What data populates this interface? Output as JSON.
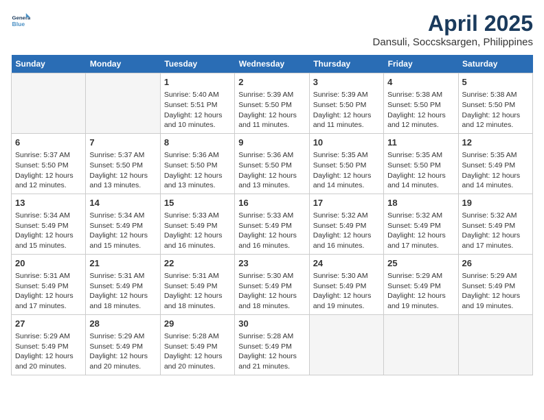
{
  "header": {
    "logo_line1": "General",
    "logo_line2": "Blue",
    "title": "April 2025",
    "subtitle": "Dansuli, Soccsksargen, Philippines"
  },
  "days_of_week": [
    "Sunday",
    "Monday",
    "Tuesday",
    "Wednesday",
    "Thursday",
    "Friday",
    "Saturday"
  ],
  "weeks": [
    [
      {
        "day": "",
        "info": ""
      },
      {
        "day": "",
        "info": ""
      },
      {
        "day": "1",
        "info": "Sunrise: 5:40 AM\nSunset: 5:51 PM\nDaylight: 12 hours and 10 minutes."
      },
      {
        "day": "2",
        "info": "Sunrise: 5:39 AM\nSunset: 5:50 PM\nDaylight: 12 hours and 11 minutes."
      },
      {
        "day": "3",
        "info": "Sunrise: 5:39 AM\nSunset: 5:50 PM\nDaylight: 12 hours and 11 minutes."
      },
      {
        "day": "4",
        "info": "Sunrise: 5:38 AM\nSunset: 5:50 PM\nDaylight: 12 hours and 12 minutes."
      },
      {
        "day": "5",
        "info": "Sunrise: 5:38 AM\nSunset: 5:50 PM\nDaylight: 12 hours and 12 minutes."
      }
    ],
    [
      {
        "day": "6",
        "info": "Sunrise: 5:37 AM\nSunset: 5:50 PM\nDaylight: 12 hours and 12 minutes."
      },
      {
        "day": "7",
        "info": "Sunrise: 5:37 AM\nSunset: 5:50 PM\nDaylight: 12 hours and 13 minutes."
      },
      {
        "day": "8",
        "info": "Sunrise: 5:36 AM\nSunset: 5:50 PM\nDaylight: 12 hours and 13 minutes."
      },
      {
        "day": "9",
        "info": "Sunrise: 5:36 AM\nSunset: 5:50 PM\nDaylight: 12 hours and 13 minutes."
      },
      {
        "day": "10",
        "info": "Sunrise: 5:35 AM\nSunset: 5:50 PM\nDaylight: 12 hours and 14 minutes."
      },
      {
        "day": "11",
        "info": "Sunrise: 5:35 AM\nSunset: 5:50 PM\nDaylight: 12 hours and 14 minutes."
      },
      {
        "day": "12",
        "info": "Sunrise: 5:35 AM\nSunset: 5:49 PM\nDaylight: 12 hours and 14 minutes."
      }
    ],
    [
      {
        "day": "13",
        "info": "Sunrise: 5:34 AM\nSunset: 5:49 PM\nDaylight: 12 hours and 15 minutes."
      },
      {
        "day": "14",
        "info": "Sunrise: 5:34 AM\nSunset: 5:49 PM\nDaylight: 12 hours and 15 minutes."
      },
      {
        "day": "15",
        "info": "Sunrise: 5:33 AM\nSunset: 5:49 PM\nDaylight: 12 hours and 16 minutes."
      },
      {
        "day": "16",
        "info": "Sunrise: 5:33 AM\nSunset: 5:49 PM\nDaylight: 12 hours and 16 minutes."
      },
      {
        "day": "17",
        "info": "Sunrise: 5:32 AM\nSunset: 5:49 PM\nDaylight: 12 hours and 16 minutes."
      },
      {
        "day": "18",
        "info": "Sunrise: 5:32 AM\nSunset: 5:49 PM\nDaylight: 12 hours and 17 minutes."
      },
      {
        "day": "19",
        "info": "Sunrise: 5:32 AM\nSunset: 5:49 PM\nDaylight: 12 hours and 17 minutes."
      }
    ],
    [
      {
        "day": "20",
        "info": "Sunrise: 5:31 AM\nSunset: 5:49 PM\nDaylight: 12 hours and 17 minutes."
      },
      {
        "day": "21",
        "info": "Sunrise: 5:31 AM\nSunset: 5:49 PM\nDaylight: 12 hours and 18 minutes."
      },
      {
        "day": "22",
        "info": "Sunrise: 5:31 AM\nSunset: 5:49 PM\nDaylight: 12 hours and 18 minutes."
      },
      {
        "day": "23",
        "info": "Sunrise: 5:30 AM\nSunset: 5:49 PM\nDaylight: 12 hours and 18 minutes."
      },
      {
        "day": "24",
        "info": "Sunrise: 5:30 AM\nSunset: 5:49 PM\nDaylight: 12 hours and 19 minutes."
      },
      {
        "day": "25",
        "info": "Sunrise: 5:29 AM\nSunset: 5:49 PM\nDaylight: 12 hours and 19 minutes."
      },
      {
        "day": "26",
        "info": "Sunrise: 5:29 AM\nSunset: 5:49 PM\nDaylight: 12 hours and 19 minutes."
      }
    ],
    [
      {
        "day": "27",
        "info": "Sunrise: 5:29 AM\nSunset: 5:49 PM\nDaylight: 12 hours and 20 minutes."
      },
      {
        "day": "28",
        "info": "Sunrise: 5:29 AM\nSunset: 5:49 PM\nDaylight: 12 hours and 20 minutes."
      },
      {
        "day": "29",
        "info": "Sunrise: 5:28 AM\nSunset: 5:49 PM\nDaylight: 12 hours and 20 minutes."
      },
      {
        "day": "30",
        "info": "Sunrise: 5:28 AM\nSunset: 5:49 PM\nDaylight: 12 hours and 21 minutes."
      },
      {
        "day": "",
        "info": ""
      },
      {
        "day": "",
        "info": ""
      },
      {
        "day": "",
        "info": ""
      }
    ]
  ]
}
